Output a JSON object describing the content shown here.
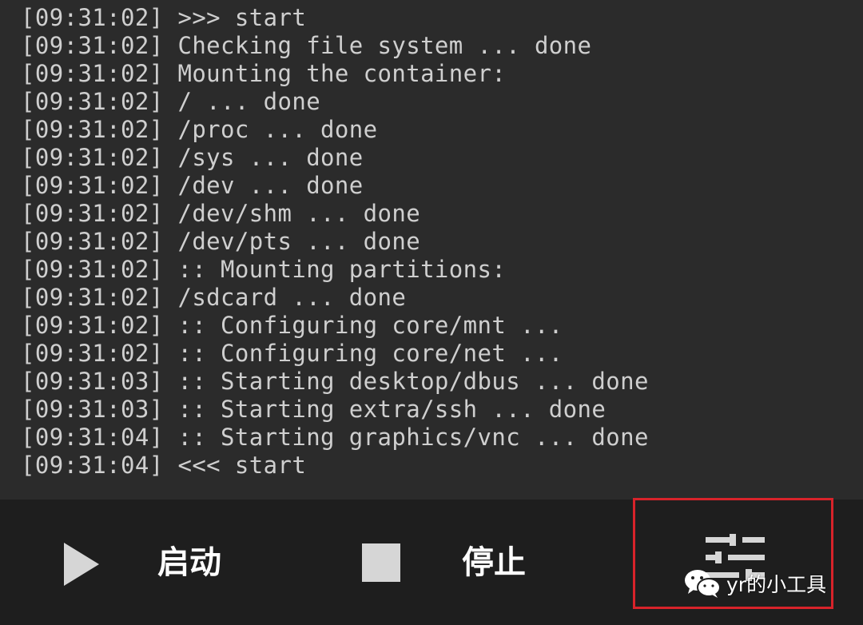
{
  "console": {
    "cut_line": "[09:31:02] >>> start",
    "lines": [
      "[09:31:02] >>> start",
      "[09:31:02] Checking file system ... done",
      "[09:31:02] Mounting the container:",
      "[09:31:02] / ... done",
      "[09:31:02] /proc ... done",
      "[09:31:02] /sys ... done",
      "[09:31:02] /dev ... done",
      "[09:31:02] /dev/shm ... done",
      "[09:31:02] /dev/pts ... done",
      "[09:31:02] :: Mounting partitions:",
      "[09:31:02] /sdcard ... done",
      "[09:31:02] :: Configuring core/mnt ...",
      "[09:31:02] :: Configuring core/net ...",
      "[09:31:03] :: Starting desktop/dbus ... done",
      "[09:31:03] :: Starting extra/ssh ... done",
      "[09:31:04] :: Starting graphics/vnc ... done",
      "[09:31:04] <<< start"
    ]
  },
  "toolbar": {
    "start_label": "启动",
    "stop_label": "停止",
    "start_icon": "play-icon",
    "stop_icon": "stop-icon",
    "settings_icon": "sliders-icon"
  },
  "watermark": {
    "text": "yr的小工具",
    "icon": "wechat-icon"
  },
  "colors": {
    "console_bg": "#2b2b2b",
    "console_text": "#cfcfcf",
    "toolbar_bg": "#1e1e1e",
    "highlight": "#d8232a"
  }
}
